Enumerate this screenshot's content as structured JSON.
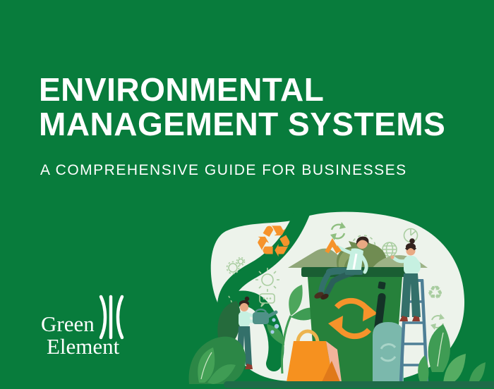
{
  "poster": {
    "title_line1": "ENVIRONMENTAL",
    "title_line2": "MANAGEMENT SYSTEMS",
    "subtitle": "A COMPREHENSIVE GUIDE FOR BUSINESSES",
    "logo": {
      "line1": "Green",
      "line2": "Element",
      "mark": "three-curved-bars"
    },
    "glyphs": {
      "recycle": "♻"
    },
    "colors": {
      "background": "#087C3C",
      "text": "#FFFFFF",
      "blob": "#EDF3EB",
      "bin": "#26813B",
      "bin_lid": "#1A5E33",
      "accent_orange": "#F6932B",
      "bag_orange": "#F6911F",
      "mint_clothing": "#C6F0E1",
      "teal_pants": "#33706A",
      "small_bin_teal": "#7BB8AC",
      "ladder_blue": "#4E7F96",
      "leaf_green": "#3F9C54",
      "ground_bar": "#1E6B48"
    },
    "illustration": {
      "description": "People sorting waste around a large recycling bin",
      "icons": [
        "recycle-icon",
        "circular-arrows-icon",
        "gear-icon",
        "sun-icon",
        "speech-bubble-icon",
        "dashed-circle-icon",
        "globe-icon",
        "pie-chart-icon",
        "leaf-icon",
        "watering-can-icon",
        "shopping-bag-icon",
        "ladder-icon",
        "trash-bin-icon"
      ]
    }
  }
}
